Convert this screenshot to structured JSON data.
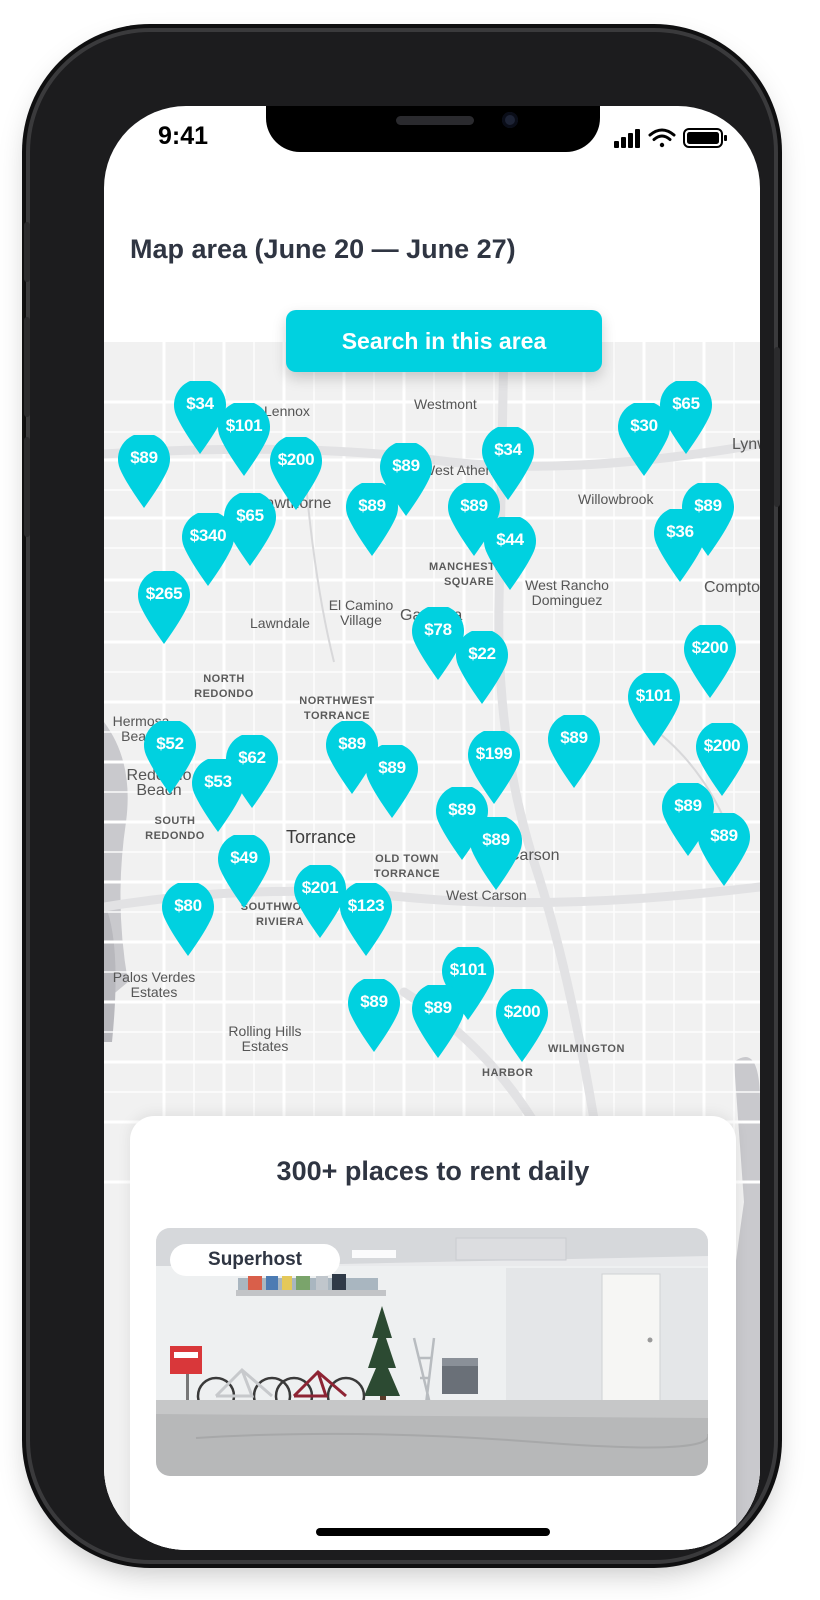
{
  "status_bar": {
    "time": "9:41"
  },
  "header": {
    "title": "Map area (June 20 — June 27)"
  },
  "map": {
    "search_button_label": "Search in this area",
    "labels": [
      "Westmont",
      "Lennox",
      "Hawthorne",
      "West Athens",
      "Willowbrook",
      "Lynwood",
      "MANCHESTER SQUARE",
      "West Rancho Dominguez",
      "Compton",
      "El Camino Village",
      "Lawndale",
      "Gardena",
      "NORTH REDONDO",
      "NORTHWEST TORRANCE",
      "Hermosa Beach",
      "Redondo Beach",
      "SOUTH REDONDO",
      "Torrance",
      "OLD TOWN TORRANCE",
      "West Carson",
      "Carson",
      "SOUTHWOOD RIVIERA",
      "Palos Verdes Estates",
      "Rolling Hills Estates",
      "WILMINGTON",
      "HARBOR"
    ],
    "pins": [
      "$34",
      "$101",
      "$89",
      "$200",
      "$89",
      "$34",
      "$30",
      "$65",
      "$89",
      "$89",
      "$89",
      "$65",
      "$340",
      "$44",
      "$36",
      "$265",
      "$78",
      "$22",
      "$200",
      "$101",
      "$52",
      "$62",
      "$53",
      "$89",
      "$89",
      "$199",
      "$89",
      "$200",
      "$89",
      "$89",
      "$89",
      "$89",
      "$49",
      "$80",
      "$201",
      "$123",
      "$101",
      "$89",
      "$89",
      "$200"
    ],
    "accent_color": "#00D1E0"
  },
  "listings_card": {
    "title": "300+ places to rent daily",
    "badge": "Superhost"
  }
}
